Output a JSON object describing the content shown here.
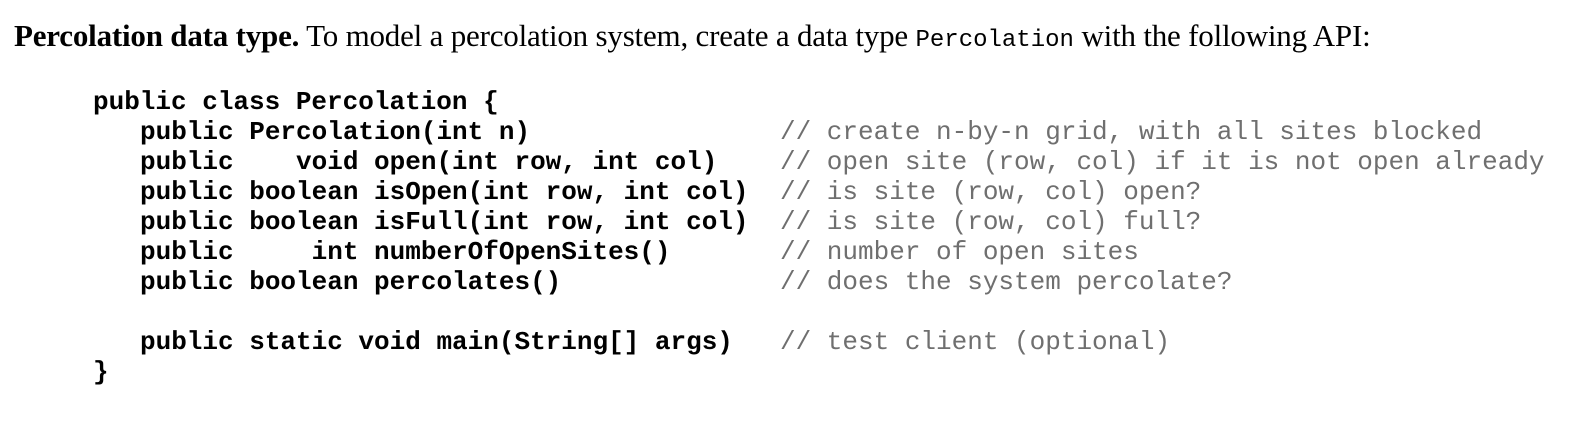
{
  "heading": {
    "bold_text": "Percolation data type.",
    "text_before_code": " To model a percolation system, create a data type ",
    "inline_code": "Percolation",
    "text_after_code": " with the following API:"
  },
  "code": {
    "class_open": "public class Percolation {",
    "lines": [
      {
        "signature": "public Percolation(int n)",
        "comment": "// create n-by-n grid, with all sites blocked"
      },
      {
        "signature": "public    void open(int row, int col)",
        "comment": "// open site (row, col) if it is not open already"
      },
      {
        "signature": "public boolean isOpen(int row, int col)",
        "comment": "// is site (row, col) open?"
      },
      {
        "signature": "public boolean isFull(int row, int col)",
        "comment": "// is site (row, col) full?"
      },
      {
        "signature": "public     int numberOfOpenSites()",
        "comment": "// number of open sites"
      },
      {
        "signature": "public boolean percolates()",
        "comment": "// does the system percolate?"
      },
      {
        "signature": "",
        "comment": ""
      },
      {
        "signature": "public static void main(String[] args)",
        "comment": "// test client (optional)"
      }
    ],
    "class_close": "}"
  }
}
